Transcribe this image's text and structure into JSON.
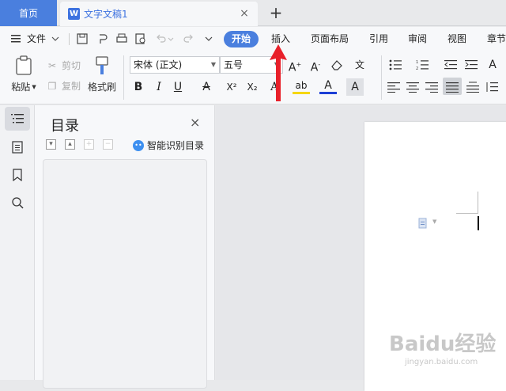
{
  "tabs": {
    "home": "首页",
    "document": "文字文稿1",
    "doc_icon": "W",
    "close": "×",
    "new": "+"
  },
  "menu": {
    "file": "文件",
    "items": [
      "开始",
      "插入",
      "页面布局",
      "引用",
      "审阅",
      "视图",
      "章节"
    ],
    "active": "开始"
  },
  "ribbon": {
    "paste": "粘贴",
    "cut": "剪切",
    "copy": "复制",
    "format_painter": "格式刷",
    "font_name": "宋体 (正文)",
    "font_size": "五号",
    "bold": "B",
    "italic": "I",
    "underline": "U",
    "superscript": "X²",
    "subscript": "X₂",
    "highlight": "ab",
    "font_color": "A"
  },
  "toc": {
    "title": "目录",
    "ai_toc": "智能识别目录",
    "close": "×"
  },
  "watermark": {
    "brand": "Baidu经验",
    "url": "jingyan.baidu.com"
  },
  "colors": {
    "accent": "#4a7fde",
    "annotation_arrow": "#e8202a"
  }
}
